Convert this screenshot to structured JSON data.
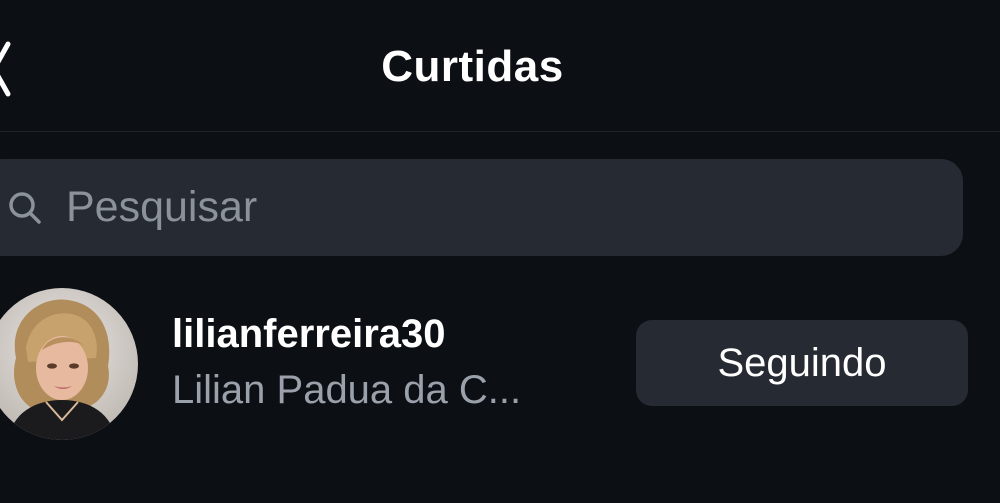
{
  "header": {
    "title": "Curtidas",
    "back_icon": "chevron-left-icon"
  },
  "search": {
    "placeholder": "Pesquisar",
    "value": "",
    "icon": "search-icon"
  },
  "likes": [
    {
      "username": "lilianferreira30",
      "full_name": "Lilian Padua da C...",
      "follow_label": "Seguindo"
    }
  ],
  "colors": {
    "background": "#0c0f14",
    "surface": "#262a32",
    "text_primary": "#ffffff",
    "text_secondary": "#9aa1ab",
    "placeholder": "#8c929c"
  }
}
